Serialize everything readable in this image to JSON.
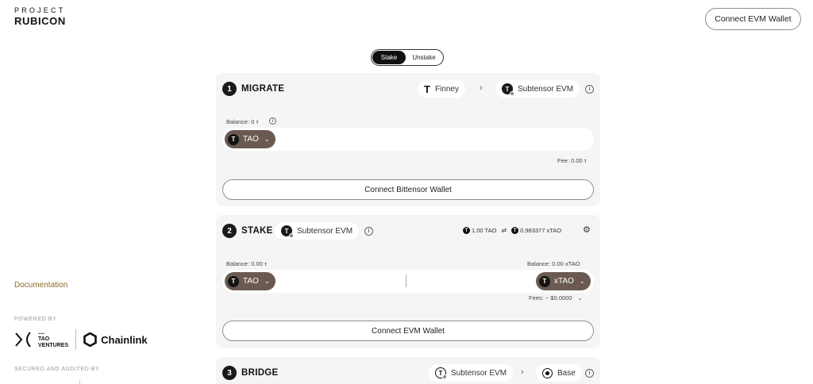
{
  "logo": {
    "top": "PROJECT",
    "bottom": "RUBICON"
  },
  "header": {
    "connect_evm_label": "Connect EVM Wallet"
  },
  "sidebar": {
    "docs_label": "Documentation",
    "powered_by": "POWERED BY",
    "partners": {
      "tao_line1": "TAO",
      "tao_line2": "VENTURES",
      "chainlink": "Chainlink"
    },
    "secured_by": "SECURED AND AUDITED BY"
  },
  "toggle": {
    "stake": "Stake",
    "unstake": "Unstake",
    "active": "Stake"
  },
  "migrate": {
    "step": "1",
    "title": "MIGRATE",
    "from_network": "Finney",
    "to_network": "Subtensor EVM",
    "balance_label": "Balance: 0 τ",
    "token": "TAO",
    "fee": "Fee: 0.00 τ",
    "connect_label": "Connect Bittensor Wallet"
  },
  "stake": {
    "step": "2",
    "title": "STAKE",
    "network": "Subtensor EVM",
    "rate_from": "1.00 TAO",
    "rate_to": "0.983377 xTAO",
    "balance_left": "Balance: 0.00 τ",
    "balance_right": "Balance: 0.00 xTAO",
    "token_in": "TAO",
    "token_out": "xTAO",
    "fees": "Fees: ~ $0.0000",
    "connect_label": "Connect EVM Wallet"
  },
  "bridge": {
    "step": "3",
    "title": "BRIDGE",
    "from_network": "Subtensor EVM",
    "to_network": "Base"
  },
  "icons": {
    "finney": "T-glyph-icon",
    "subtensor": "subtensor-icon",
    "base": "base-icon",
    "info": "info-icon",
    "gear": "gear-icon",
    "chevron": "chevron-down-icon",
    "arrow": "chevron-right-icon"
  },
  "colors": {
    "token_pill": "#6b5a52",
    "docs_link": "#8a6a2a",
    "card_bg": "#f5f5f5"
  }
}
